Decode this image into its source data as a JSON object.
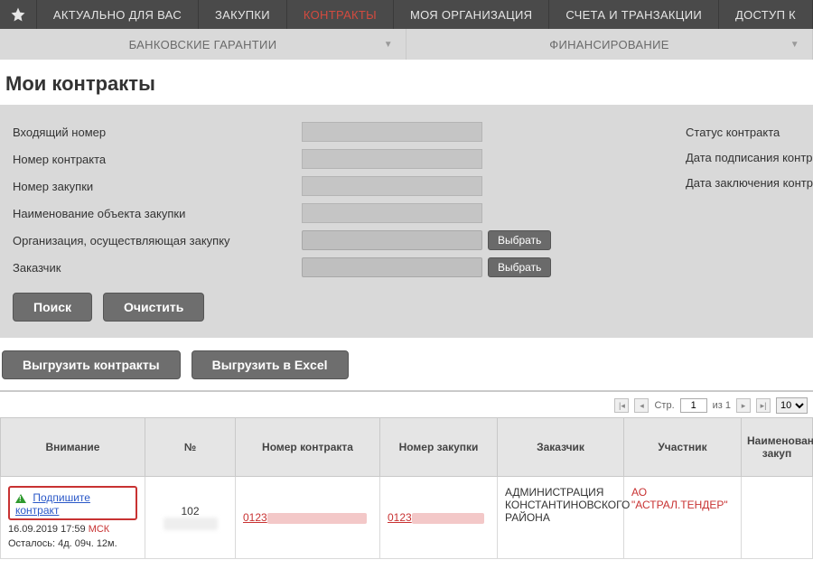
{
  "topnav": {
    "items": [
      "АКТУАЛЬНО ДЛЯ ВАС",
      "ЗАКУПКИ",
      "КОНТРАКТЫ",
      "МОЯ ОРГАНИЗАЦИЯ",
      "СЧЕТА И ТРАНЗАКЦИИ",
      "ДОСТУП К"
    ],
    "active_index": 2
  },
  "subnav": {
    "tabs": [
      "БАНКОВСКИЕ ГАРАНТИИ",
      "ФИНАНСИРОВАНИЕ"
    ]
  },
  "page_title": "Мои контракты",
  "filters": {
    "labels": {
      "incoming_number": "Входящий номер",
      "contract_number": "Номер контракта",
      "purchase_number": "Номер закупки",
      "object_name": "Наименование объекта закупки",
      "purchasing_org": "Организация, осуществляющая закупку",
      "customer": "Заказчик"
    },
    "choose_btn": "Выбрать",
    "right_labels": {
      "status": "Статус контракта",
      "sign_date": "Дата подписания контр",
      "conclude_date": "Дата заключения контр"
    },
    "search_btn": "Поиск",
    "clear_btn": "Очистить"
  },
  "export": {
    "contracts": "Выгрузить контракты",
    "excel": "Выгрузить в Excel"
  },
  "pager": {
    "page_label_prefix": "Стр.",
    "page_value": "1",
    "page_label_suffix": "из 1",
    "per_page": "10"
  },
  "grid": {
    "headers": [
      "Внимание",
      "№",
      "Номер контракта",
      "Номер закупки",
      "Заказчик",
      "Участник",
      "Наименование закуп"
    ],
    "row": {
      "attention_link": "Подпишите контракт",
      "datetime": "16.09.2019 17:59",
      "tz": "МСК",
      "remaining": "Осталось: 4д. 09ч. 12м.",
      "number": "102",
      "contract_number_prefix": "0123",
      "purchase_number_prefix": "0123",
      "customer": "АДМИНИСТРАЦИЯ КОНСТАНТИНОВСКОГО РАЙОНА",
      "participant": "АО \"АСТРАЛ.ТЕНДЕР\""
    }
  }
}
